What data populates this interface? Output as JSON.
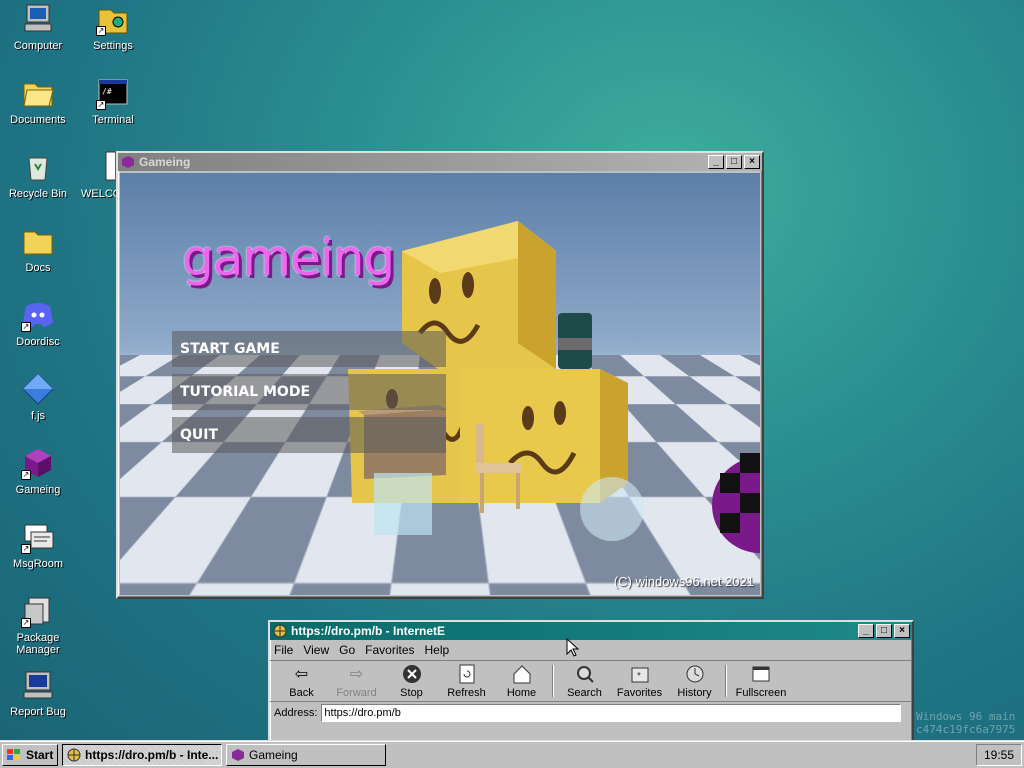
{
  "desktop": {
    "icons": [
      {
        "label": "Computer"
      },
      {
        "label": "Settings"
      },
      {
        "label": "Documents"
      },
      {
        "label": "Terminal"
      },
      {
        "label": "Recycle Bin"
      },
      {
        "label": "WELCO"
      },
      {
        "label": "Docs"
      },
      {
        "label": "Doordisc"
      },
      {
        "label": "f.js"
      },
      {
        "label": "Gameing"
      },
      {
        "label": "MsgRoom"
      },
      {
        "label": "Package Manager"
      },
      {
        "label": "Report Bug"
      }
    ]
  },
  "game_window": {
    "title": "Gameing",
    "heading": "gameing",
    "menu": [
      "START GAME",
      "TUTORIAL MODE",
      "QUIT"
    ],
    "copyright": "(C) windows96.net 2021"
  },
  "browser_window": {
    "title": "https://dro.pm/b - InternetE",
    "menu": [
      "File",
      "View",
      "Go",
      "Favorites",
      "Help"
    ],
    "toolbar": [
      {
        "label": "Back",
        "icon": "back-arrow-icon",
        "enabled": true
      },
      {
        "label": "Forward",
        "icon": "forward-arrow-icon",
        "enabled": false
      },
      {
        "label": "Stop",
        "icon": "stop-icon",
        "enabled": true
      },
      {
        "label": "Refresh",
        "icon": "refresh-icon",
        "enabled": true
      },
      {
        "label": "Home",
        "icon": "home-icon",
        "enabled": true
      },
      {
        "label": "Search",
        "icon": "search-icon",
        "enabled": true
      },
      {
        "label": "Favorites",
        "icon": "favorites-icon",
        "enabled": true
      },
      {
        "label": "History",
        "icon": "history-icon",
        "enabled": true
      },
      {
        "label": "Fullscreen",
        "icon": "fullscreen-icon",
        "enabled": true
      }
    ],
    "address_label": "Address:",
    "address_value": "https://dro.pm/b"
  },
  "taskbar": {
    "start_label": "Start",
    "tasks": [
      "https://dro.pm/b - Inte...",
      "Gameing"
    ],
    "clock": "19:55"
  },
  "watermark": {
    "line1": "Windows 96 main",
    "line2": "c474c19fc6a7975"
  },
  "colors": {
    "desktop_bg": "#2a8e90",
    "title_active": "#0a6a6a",
    "game_title": "#ee66f0",
    "window_face": "#c0c0c0"
  }
}
